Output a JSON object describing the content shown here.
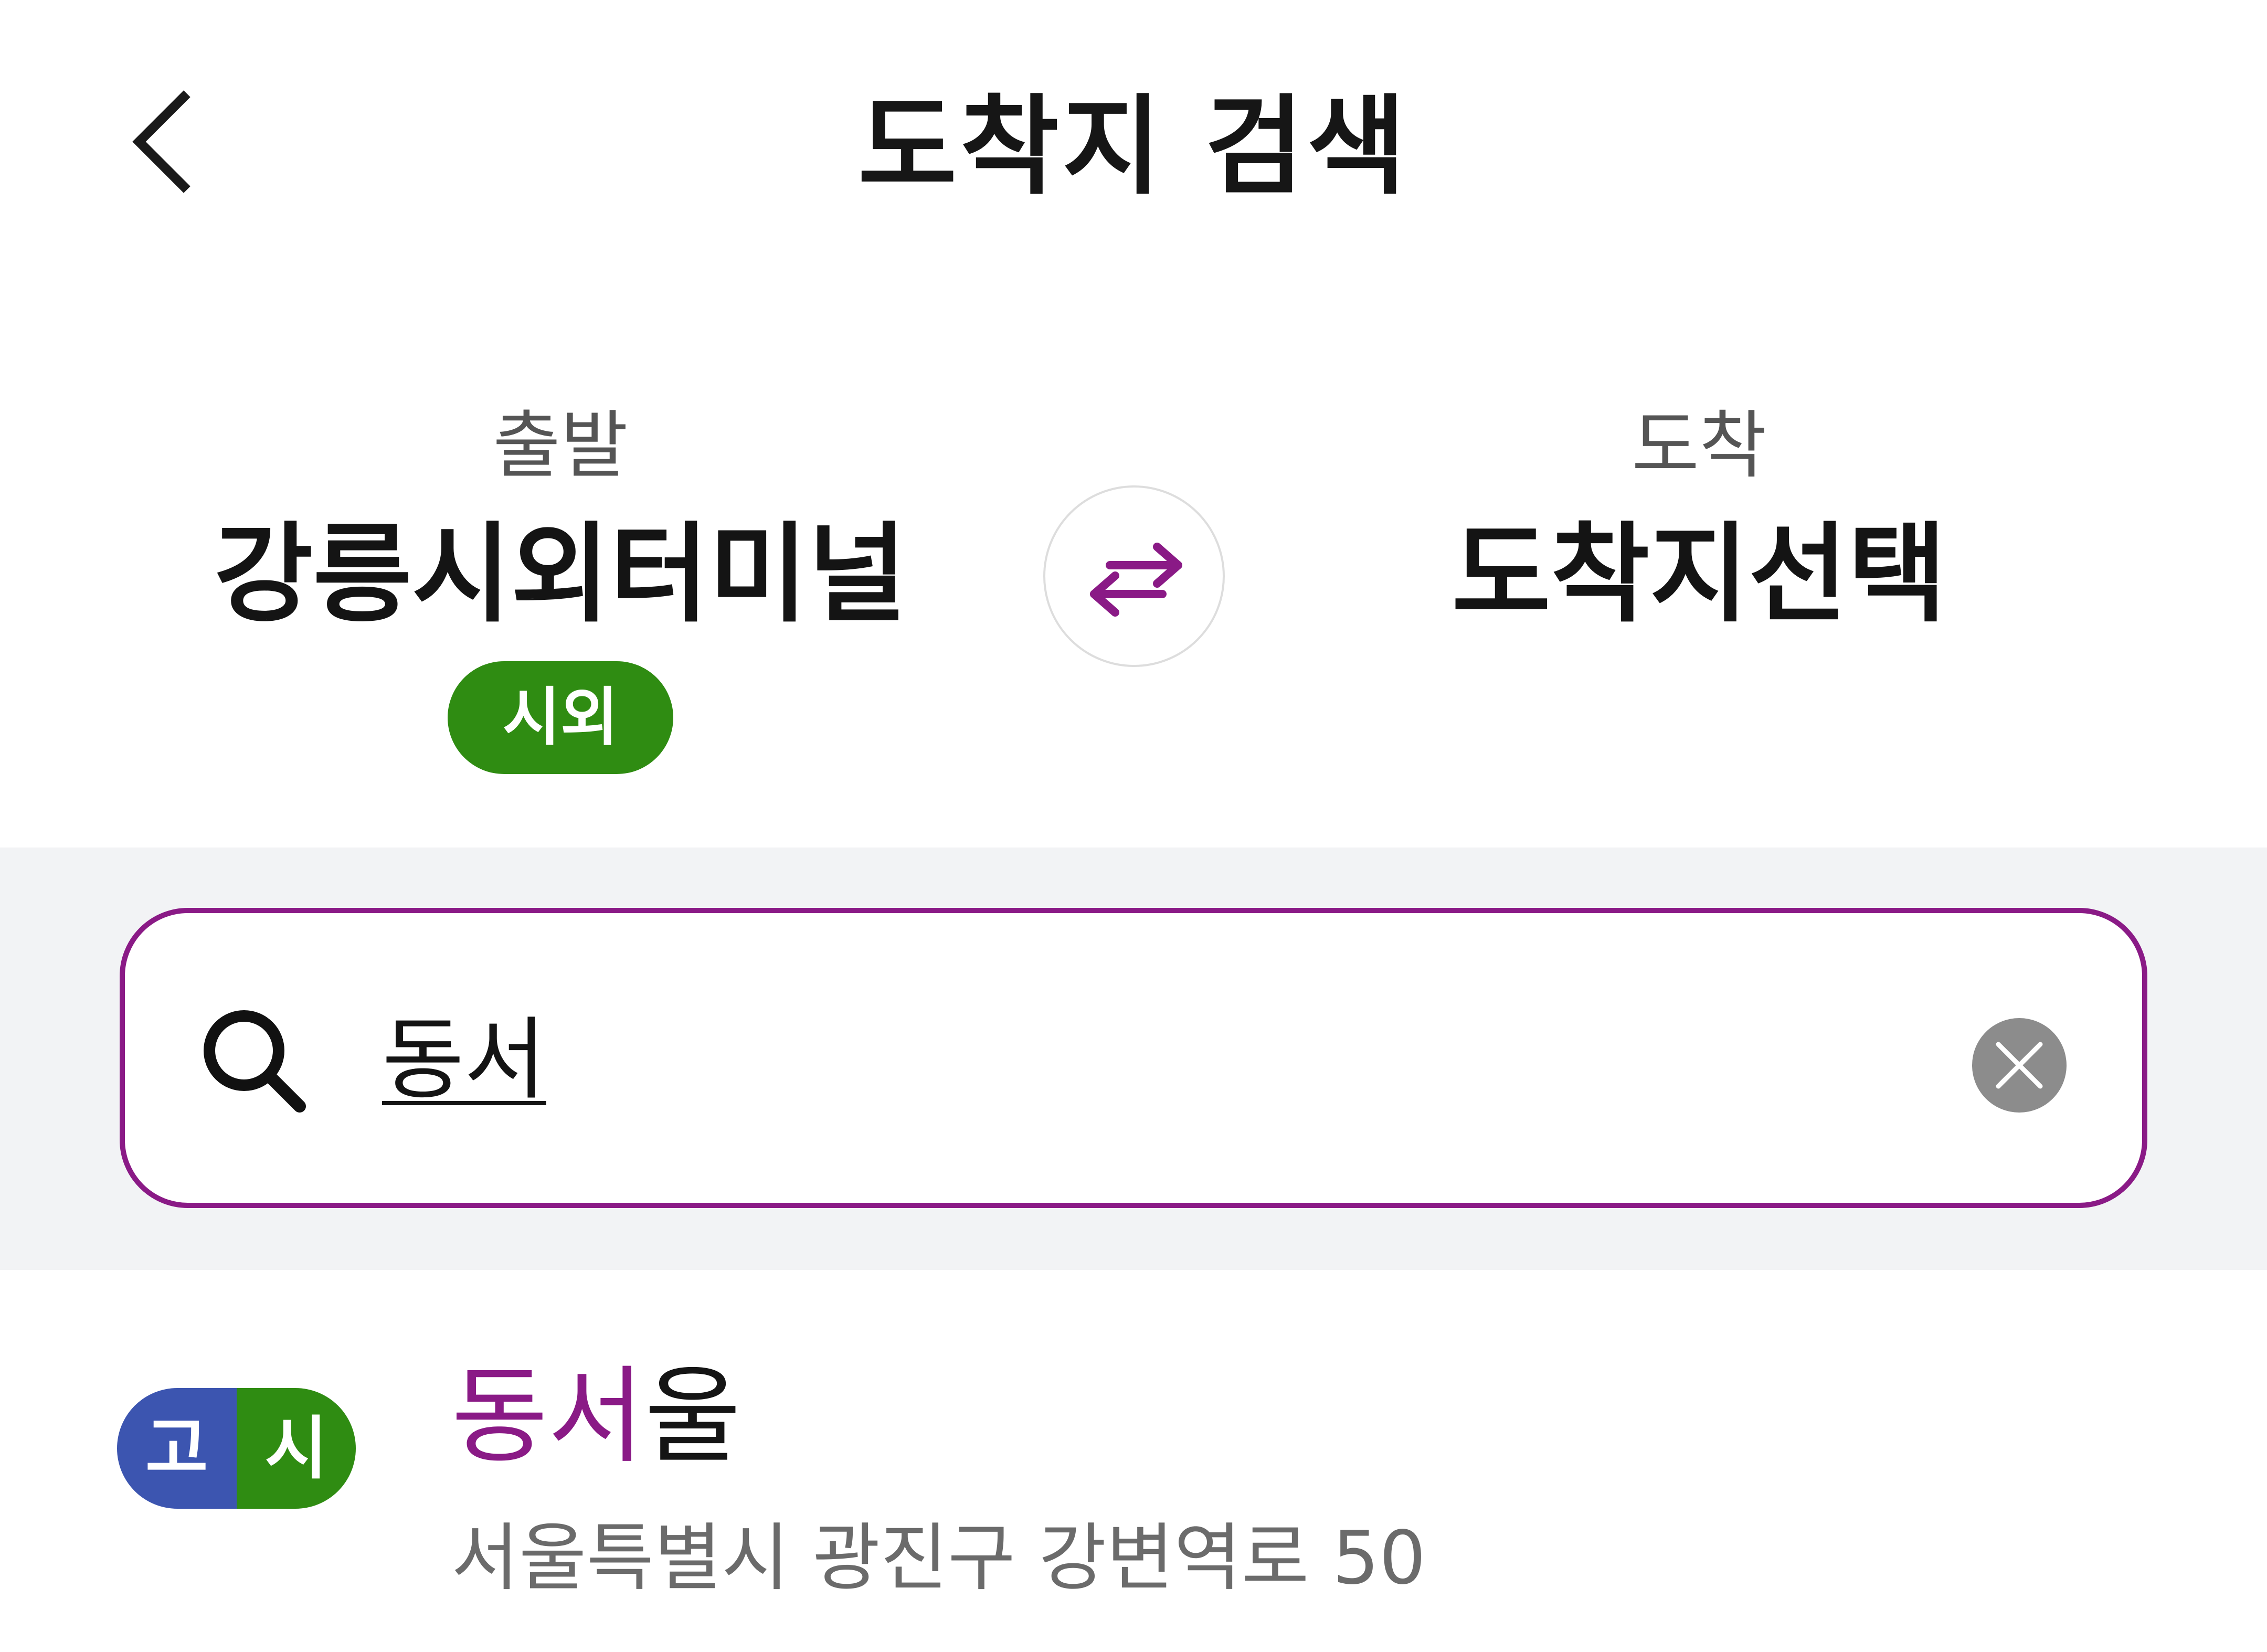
{
  "header": {
    "title": "도착지 검색",
    "back_icon": "chevron-left-icon"
  },
  "route": {
    "departure_label": "출발",
    "departure_value": "강릉시외터미널",
    "departure_badge": "시외",
    "arrival_label": "도착",
    "arrival_value": "도착지선택",
    "swap_icon": "swap-arrows-icon"
  },
  "search": {
    "value": "동서",
    "search_icon": "search-icon",
    "clear_icon": "clear-icon"
  },
  "results": [
    {
      "badges": [
        "고",
        "시"
      ],
      "name_highlight": "동서",
      "name_rest": "울",
      "address": "서울특별시 광진구 강변역로 50"
    }
  ],
  "colors": {
    "accent": "#8a1a86",
    "intercity_green": "#2f8c12",
    "express_blue": "#3c55b0",
    "search_band_bg": "#f2f3f5",
    "clear_button_gray": "#8c8c8c"
  }
}
